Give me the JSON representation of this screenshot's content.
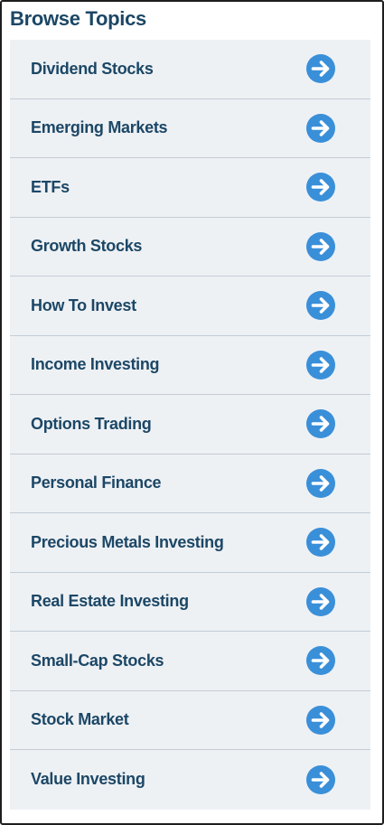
{
  "widget": {
    "title": "Browse Topics",
    "accent_color": "#3a8fd9",
    "text_color": "#1c4766",
    "item_background": "#eef1f4",
    "item_icon": "arrow-right-circle-icon"
  },
  "topics": [
    {
      "label": "Dividend Stocks"
    },
    {
      "label": "Emerging Markets"
    },
    {
      "label": "ETFs"
    },
    {
      "label": "Growth Stocks"
    },
    {
      "label": "How To Invest"
    },
    {
      "label": "Income Investing"
    },
    {
      "label": "Options Trading"
    },
    {
      "label": "Personal Finance"
    },
    {
      "label": "Precious Metals Investing"
    },
    {
      "label": "Real Estate Investing"
    },
    {
      "label": "Small-Cap Stocks"
    },
    {
      "label": "Stock Market"
    },
    {
      "label": "Value Investing"
    }
  ]
}
